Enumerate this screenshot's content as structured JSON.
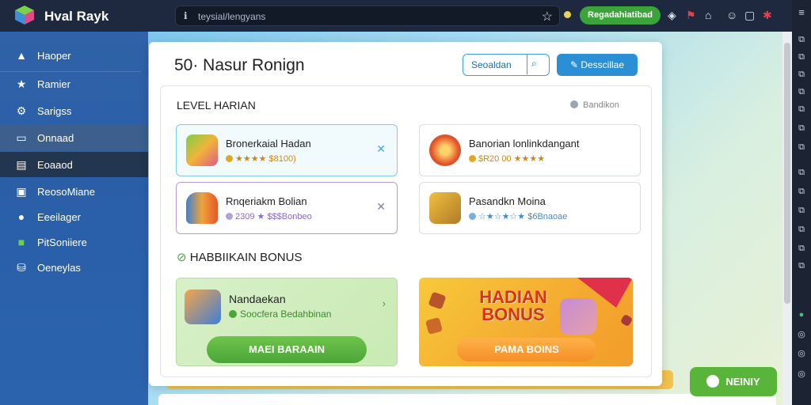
{
  "app": {
    "title": "Hval Rayk"
  },
  "browser": {
    "url": "teysial/lengyans",
    "status_pill": "Regadahiatibad"
  },
  "sidebar": {
    "items": [
      {
        "label": "Haoper",
        "icon": "home-icon"
      },
      {
        "label": "Ramier",
        "icon": "star-icon"
      },
      {
        "label": "Sarigss",
        "icon": "gear-icon"
      },
      {
        "label": "Onnaad",
        "icon": "monitor-icon"
      },
      {
        "label": "Eoaaod",
        "icon": "dashboard-icon"
      },
      {
        "label": "ReosoMiane",
        "icon": "user-card-icon"
      },
      {
        "label": "Eeeilager",
        "icon": "person-icon"
      },
      {
        "label": "PitSoniiere",
        "icon": "puzzle-icon"
      },
      {
        "label": "Oeneylas",
        "icon": "database-icon"
      }
    ]
  },
  "modal": {
    "title": "50· Nasur Ronign",
    "outline_button": "Seoaldan",
    "primary_button": "Desscillae",
    "level_section": {
      "title": "LEVEL HARIAN",
      "see_all": "Bandikon"
    },
    "cards": [
      {
        "name": "Bronerkaial Hadan",
        "meta": "★★★★ $8100)"
      },
      {
        "name": "Banorian lonlinkdangant",
        "meta": "$R20 00 ★★★★"
      },
      {
        "name": "Rnqeriakm Bolian",
        "meta": "2309 ★ $$$Bonbeo"
      },
      {
        "name": "Pasandkn Moina",
        "meta": "☆★☆★☆★ $6Bnaoae"
      }
    ],
    "bonus_section": {
      "title": "HABBIIKAIN BONUS"
    },
    "bonus_left": {
      "name": "Nandaekan",
      "meta": "Soocfera Bedahbinan",
      "cta": "MAEI BARAAIN"
    },
    "bonus_right": {
      "headline": "HADIAN BONUS",
      "cta": "PAMA BOINS"
    }
  },
  "float_button": "NEINIY",
  "colors": {
    "sidebar": "#2f62a7",
    "primary": "#2b8fd6",
    "green": "#58b53a",
    "orange": "#f4a930"
  }
}
